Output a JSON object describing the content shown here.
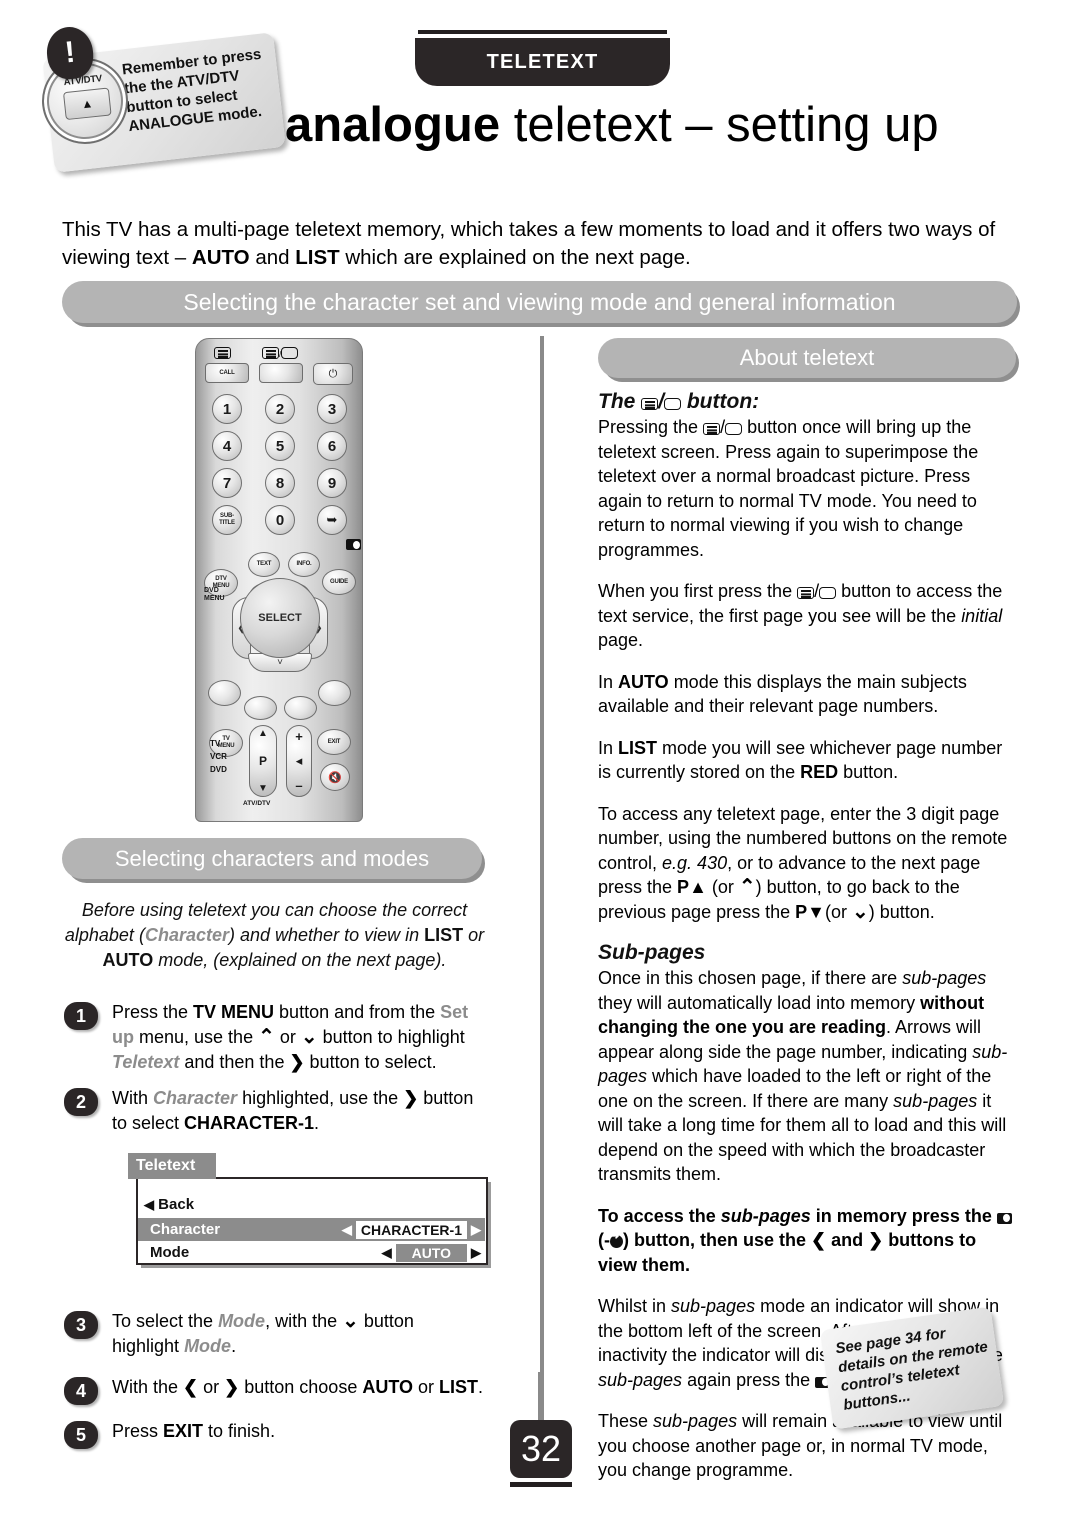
{
  "header": {
    "tab_label": "TELETEXT",
    "title_bold": "analogue",
    "title_rest": " teletext – setting up"
  },
  "sticker_remember": {
    "badge": "!",
    "knob_label": "ATV/DTV",
    "knob_glyph": "▲",
    "text": "Remember to press the the ATV/DTV button to select ANALOGUE mode."
  },
  "intro": {
    "line_a": "This TV has a multi-page teletext memory, which takes a few moments to load and it offers two ways of viewing text – ",
    "auto": "AUTO",
    "and": " and ",
    "list": "LIST",
    "line_b": " which are explained on the next page."
  },
  "pills": {
    "main": "Selecting the character set and viewing mode and general information",
    "about": "About teletext",
    "chars": "Selecting characters and modes"
  },
  "remote": {
    "call_label": "CALL",
    "power_glyph": "⏻",
    "keys": [
      "1",
      "2",
      "3",
      "4",
      "5",
      "6",
      "7",
      "8",
      "9",
      "0"
    ],
    "subtitle_label": "SUB-\nTITLE",
    "source_glyph": "←⊙",
    "text_label": "TEXT",
    "info_label": "INFO.",
    "dtv_menu_label": "DTV\nMENU",
    "dvd_menu_label": "DVD\nMENU",
    "guide_label": "GUIDE",
    "select_label": "SELECT",
    "tv_menu_label": "TV\nMENU",
    "exit_label": "EXIT",
    "mute_glyph": "တ2",
    "p_label": "P",
    "up_glyph": "▲",
    "down_glyph": "▼",
    "vol_plus": "+",
    "vol_minus": "–",
    "device_labels": [
      "TV",
      "VCR",
      "DVD"
    ],
    "bottom_labels": [
      "ATV/DTV"
    ]
  },
  "chars_intro": {
    "l1_a": "Before using teletext you can choose the correct alphabet",
    "l2_a": "(",
    "l2_char": "Character",
    "l2_b": ") and whether to view in ",
    "l2_list": "LIST",
    "l2_c": " or ",
    "l2_auto": "AUTO",
    "l2_d": " mode,",
    "l3": "(explained on the next page)."
  },
  "steps": [
    {
      "num": "1",
      "t1": "Press the ",
      "b1": "TV MENU",
      "t2": " button and from the ",
      "g1": "Set up",
      "t3": " menu, use the ",
      "arrow_up": "⌃",
      "t4": " or ",
      "arrow_down": "⌄",
      "t5": " button to highlight ",
      "g2": "Teletext",
      "t6": " and then the ",
      "arrow_right": "❯",
      "t7": " button to select."
    },
    {
      "num": "2",
      "t1": "With ",
      "g1": "Character",
      "t2": " highlighted, use the ",
      "arrow_right": "❯",
      "t3": " button to select ",
      "b1": "CHARACTER-1",
      "t4": "."
    },
    {
      "num": "3",
      "t1": "To select the ",
      "g1": "Mode",
      "t2": ", with the ",
      "arrow_down": "⌄",
      "t3": " button highlight ",
      "g2": "Mode",
      "t4": "."
    },
    {
      "num": "4",
      "t1": "With the ",
      "arrow_left": "❮",
      "t2": " or ",
      "arrow_right": "❯",
      "t3": " button choose ",
      "b1": "AUTO",
      "t4": " or ",
      "b2": "LIST",
      "t5": "."
    },
    {
      "num": "5",
      "t1": "Press ",
      "b1": "EXIT",
      "t2": " to finish."
    }
  ],
  "osd": {
    "title": "Teletext",
    "back_label": "Back",
    "back_caret": "◀",
    "rows": [
      {
        "label": "Character",
        "value": "CHARACTER-1",
        "left_caret": "◀",
        "right_caret": "▶"
      },
      {
        "label": "Mode",
        "value": "AUTO",
        "left_caret": "◀",
        "right_caret": "▶"
      }
    ]
  },
  "about": {
    "heading_pre": "The ",
    "heading_post": " button:",
    "p1_a": "Pressing the ",
    "p1_b": " button once will bring up the teletext screen. Press again to superimpose the teletext over a normal broadcast picture. Press again to return to normal TV mode. You need to return to normal viewing if you wish to change programmes.",
    "p2_a": "When you first press the ",
    "p2_b": " button to access the text service, the first page you see will be the ",
    "p2_i": "initial",
    "p2_c": " page.",
    "p3_a": "In ",
    "p3_auto": "AUTO",
    "p3_b": " mode this displays the main subjects available and their relevant page numbers.",
    "p4_a": "In ",
    "p4_list": "LIST",
    "p4_b": " mode you will see whichever page number is currently stored on the ",
    "p4_red": "RED",
    "p4_c": " button.",
    "p5_a": "To access any teletext page, enter the 3 digit page number, using the numbered buttons on the remote control, ",
    "p5_eg": "e.g. 430",
    "p5_b": ", or to advance to the next page press the ",
    "p5_p": "P",
    "p5_up": "▲",
    "p5_c": " (or ",
    "p5_upc": "⌃",
    "p5_d": ") button, to go back to the previous page press the ",
    "p5_p2": "P",
    "p5_dn": "▼",
    "p5_e": "(or ",
    "p5_dnc": "⌄",
    "p5_f": ") button."
  },
  "subpages": {
    "heading": "Sub-pages",
    "p1_a": "Once in this chosen page, if there are ",
    "p1_i1": "sub-pages",
    "p1_b": " they will automatically load into memory ",
    "p1_bold": "without changing the one you are reading",
    "p1_c": ". Arrows will appear along side the page number, indicating ",
    "p1_i2": "sub-pages",
    "p1_d": " which have loaded to the left or right of the one on the screen. If there are many ",
    "p1_i3": "sub-pages",
    "p1_e": " it will take a long time for them all to load and this will depend on the speed with which the broadcaster transmits them.",
    "p2_a": "To access the ",
    "p2_i": "sub-pages",
    "p2_b": " in memory press the ",
    "p2_c": "(-",
    "p2_d": ") button, then use the ",
    "p2_left": "❮",
    "p2_e": " and ",
    "p2_right": "❯",
    "p2_f": " buttons to view them.",
    "p3_a": "Whilst in ",
    "p3_i": "sub-pages",
    "p3_b": " mode an indicator will show in the bottom left of the screen. After a short time of inactivity the indicator will disappear. To access the ",
    "p3_i2": "sub-pages",
    "p3_c": " again press the ",
    "p3_d": "(-",
    "p3_e": ") button.",
    "p4_a": "These ",
    "p4_i": "sub-pages",
    "p4_b": " will remain available to view until you choose another page or, in normal TV mode, you change programme."
  },
  "sticker_seepage": {
    "text": "See page 34 for details on the remote control’s teletext buttons..."
  },
  "page_number": "32",
  "colors": {
    "pill": "#b4b4b4",
    "dark": "#2b2627",
    "gray_text": "#8c8c8c"
  }
}
